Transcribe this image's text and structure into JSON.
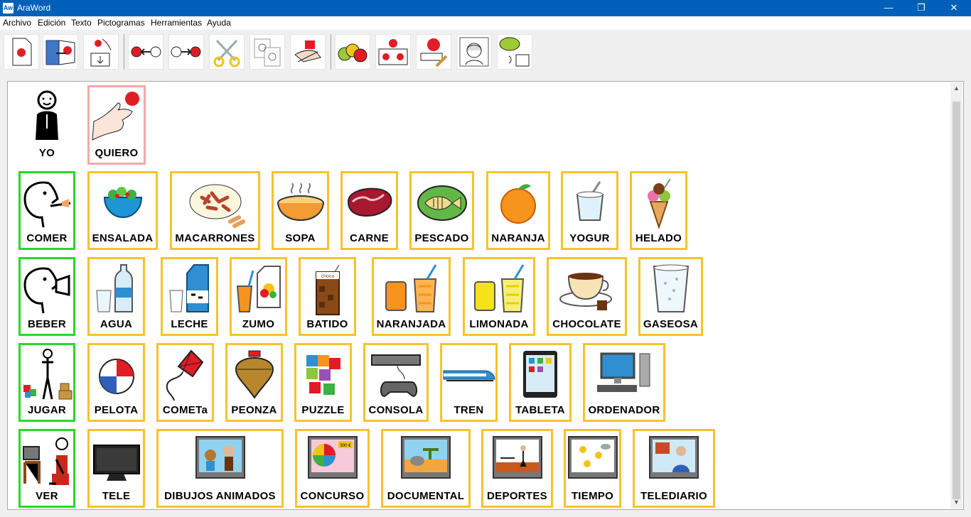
{
  "window": {
    "title": "AraWord",
    "app_icon": "Aw",
    "minimize_glyph": "—",
    "restore_glyph": "❐",
    "close_glyph": "✕"
  },
  "menu": [
    "Archivo",
    "Edición",
    "Texto",
    "Pictogramas",
    "Herramientas",
    "Ayuda"
  ],
  "toolbar": [
    {
      "icon": "new-document-icon"
    },
    {
      "icon": "open-document-icon"
    },
    {
      "icon": "save-document-icon"
    },
    {
      "icon": "move-left-icon"
    },
    {
      "icon": "move-right-icon"
    },
    {
      "icon": "cut-icon"
    },
    {
      "icon": "copy-icon"
    },
    {
      "icon": "paste-icon"
    },
    {
      "icon": "pictograms-icon"
    },
    {
      "icon": "change-pictogram-icon"
    },
    {
      "icon": "edit-pictogram-icon"
    },
    {
      "icon": "user-face-icon"
    },
    {
      "icon": "speak-text-icon"
    }
  ],
  "rows": [
    [
      {
        "label": "YO",
        "icon": "person-me-icon",
        "kind": "plain"
      },
      {
        "label": "QUIERO",
        "icon": "hand-want-icon",
        "kind": "want"
      }
    ],
    [
      {
        "label": "COMER",
        "icon": "person-eating-icon",
        "kind": "verb"
      },
      {
        "label": "ENSALADA",
        "icon": "salad-icon",
        "kind": "noun"
      },
      {
        "label": "MACARRONES",
        "icon": "macaroni-icon",
        "kind": "noun"
      },
      {
        "label": "SOPA",
        "icon": "soup-icon",
        "kind": "noun"
      },
      {
        "label": "CARNE",
        "icon": "meat-icon",
        "kind": "noun"
      },
      {
        "label": "PESCADO",
        "icon": "fish-icon",
        "kind": "noun"
      },
      {
        "label": "NARANJA",
        "icon": "orange-icon",
        "kind": "noun"
      },
      {
        "label": "YOGUR",
        "icon": "yogurt-icon",
        "kind": "noun"
      },
      {
        "label": "HELADO",
        "icon": "ice-cream-icon",
        "kind": "noun"
      }
    ],
    [
      {
        "label": "BEBER",
        "icon": "person-drinking-icon",
        "kind": "verb"
      },
      {
        "label": "AGUA",
        "icon": "water-bottle-icon",
        "kind": "noun"
      },
      {
        "label": "LECHE",
        "icon": "milk-carton-icon",
        "kind": "noun"
      },
      {
        "label": "ZUMO",
        "icon": "juice-icon",
        "kind": "noun"
      },
      {
        "label": "BATIDO",
        "icon": "milkshake-icon",
        "kind": "noun",
        "caption": "choco"
      },
      {
        "label": "NARANJADA",
        "icon": "orangeade-icon",
        "kind": "noun"
      },
      {
        "label": "LIMONADA",
        "icon": "lemonade-icon",
        "kind": "noun"
      },
      {
        "label": "CHOCOLATE",
        "icon": "hot-chocolate-icon",
        "kind": "noun"
      },
      {
        "label": "GASEOSA",
        "icon": "soda-glass-icon",
        "kind": "noun"
      }
    ],
    [
      {
        "label": "JUGAR",
        "icon": "person-playing-icon",
        "kind": "verb"
      },
      {
        "label": "PELOTA",
        "icon": "ball-icon",
        "kind": "noun"
      },
      {
        "label": "COMETa",
        "icon": "kite-icon",
        "kind": "noun"
      },
      {
        "label": "PEONZA",
        "icon": "spinning-top-icon",
        "kind": "noun"
      },
      {
        "label": "PUZZLE",
        "icon": "puzzle-icon",
        "kind": "noun"
      },
      {
        "label": "CONSOLA",
        "icon": "game-console-icon",
        "kind": "noun"
      },
      {
        "label": "TREN",
        "icon": "train-icon",
        "kind": "noun"
      },
      {
        "label": "TABLETA",
        "icon": "tablet-icon",
        "kind": "noun"
      },
      {
        "label": "ORDENADOR",
        "icon": "computer-icon",
        "kind": "noun"
      }
    ],
    [
      {
        "label": "VER",
        "icon": "person-watching-tv-icon",
        "kind": "verb"
      },
      {
        "label": "TELE",
        "icon": "television-icon",
        "kind": "noun"
      },
      {
        "label": "DIBUJOS ANIMADOS",
        "icon": "cartoons-tv-icon",
        "kind": "noun"
      },
      {
        "label": "CONCURSO",
        "icon": "quiz-show-tv-icon",
        "kind": "noun",
        "caption": "500 €"
      },
      {
        "label": "DOCUMENTAL",
        "icon": "documentary-tv-icon",
        "kind": "noun"
      },
      {
        "label": "DEPORTES",
        "icon": "sports-tv-icon",
        "kind": "noun"
      },
      {
        "label": "TIEMPO",
        "icon": "weather-tv-icon",
        "kind": "noun"
      },
      {
        "label": "TELEDIARIO",
        "icon": "news-tv-icon",
        "kind": "noun"
      }
    ]
  ],
  "colors": {
    "titlebar": "#005fb8",
    "verb_border": "#29d829",
    "noun_border": "#f7c22d",
    "want_border": "#f4a9a9"
  }
}
